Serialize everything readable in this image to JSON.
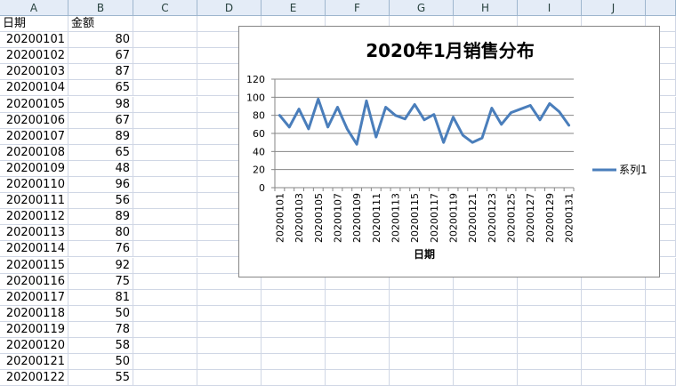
{
  "columns": [
    "A",
    "B",
    "C",
    "D",
    "E",
    "F",
    "G",
    "H",
    "I",
    "J",
    ""
  ],
  "header_row": {
    "date": "日期",
    "amount": "金额"
  },
  "rows": [
    {
      "date": "20200101",
      "amount": "80"
    },
    {
      "date": "20200102",
      "amount": "67"
    },
    {
      "date": "20200103",
      "amount": "87"
    },
    {
      "date": "20200104",
      "amount": "65"
    },
    {
      "date": "20200105",
      "amount": "98"
    },
    {
      "date": "20200106",
      "amount": "67"
    },
    {
      "date": "20200107",
      "amount": "89"
    },
    {
      "date": "20200108",
      "amount": "65"
    },
    {
      "date": "20200109",
      "amount": "48"
    },
    {
      "date": "20200110",
      "amount": "96"
    },
    {
      "date": "20200111",
      "amount": "56"
    },
    {
      "date": "20200112",
      "amount": "89"
    },
    {
      "date": "20200113",
      "amount": "80"
    },
    {
      "date": "20200114",
      "amount": "76"
    },
    {
      "date": "20200115",
      "amount": "92"
    },
    {
      "date": "20200116",
      "amount": "75"
    },
    {
      "date": "20200117",
      "amount": "81"
    },
    {
      "date": "20200118",
      "amount": "50"
    },
    {
      "date": "20200119",
      "amount": "78"
    },
    {
      "date": "20200120",
      "amount": "58"
    },
    {
      "date": "20200121",
      "amount": "50"
    },
    {
      "date": "20200122",
      "amount": "55"
    }
  ],
  "colors": {
    "header_bg": "#e4ecf7",
    "grid": "#d0d7e5",
    "series": "#4a7ebb",
    "gridline": "#868686"
  },
  "chart_data": {
    "type": "line",
    "title": "2020年1月销售分布",
    "xlabel": "日期",
    "ylabel": "",
    "ylim": [
      0,
      120
    ],
    "yticks": [
      "0",
      "20",
      "40",
      "60",
      "80",
      "100",
      "120"
    ],
    "grid": true,
    "legend_position": "right",
    "x": [
      "20200101",
      "20200102",
      "20200103",
      "20200104",
      "20200105",
      "20200106",
      "20200107",
      "20200108",
      "20200109",
      "20200110",
      "20200111",
      "20200112",
      "20200113",
      "20200114",
      "20200115",
      "20200116",
      "20200117",
      "20200118",
      "20200119",
      "20200120",
      "20200121",
      "20200122",
      "20200123",
      "20200124",
      "20200125",
      "20200126",
      "20200127",
      "20200128",
      "20200129",
      "20200130",
      "20200131"
    ],
    "xticks_shown": [
      "20200101",
      "20200103",
      "20200105",
      "20200107",
      "20200109",
      "20200111",
      "20200113",
      "20200115",
      "20200117",
      "20200119",
      "20200121",
      "20200123",
      "20200125",
      "20200127",
      "20200129",
      "20200131"
    ],
    "series": [
      {
        "name": "系列1",
        "values": [
          80,
          67,
          87,
          65,
          98,
          67,
          89,
          65,
          48,
          96,
          56,
          89,
          80,
          76,
          92,
          75,
          81,
          50,
          78,
          58,
          50,
          55,
          88,
          70,
          83,
          87,
          91,
          75,
          93,
          84,
          69
        ]
      }
    ]
  }
}
